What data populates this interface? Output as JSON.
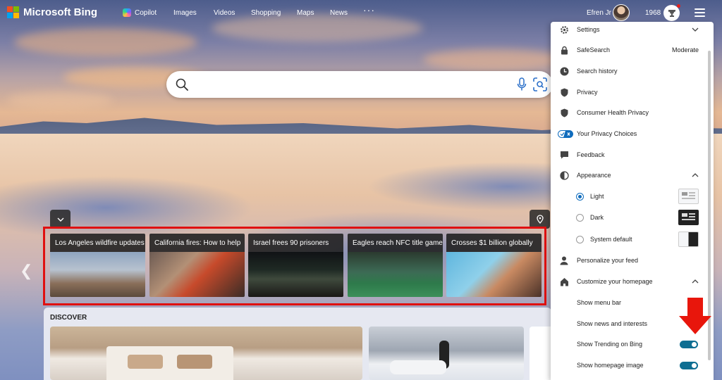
{
  "brand": {
    "name": "Microsoft Bing"
  },
  "nav": {
    "items": [
      "Copilot",
      "Images",
      "Videos",
      "Shopping",
      "Maps",
      "News"
    ],
    "more": "···"
  },
  "user": {
    "name": "Efren Jr",
    "points": "1968"
  },
  "trending": {
    "cards": [
      {
        "title": "Los Angeles wildfire updates"
      },
      {
        "title": "California fires: How to help"
      },
      {
        "title": "Israel frees 90 prisoners"
      },
      {
        "title": "Eagles reach NFC title game"
      },
      {
        "title": "Crosses $1 billion globally"
      }
    ]
  },
  "discover": {
    "title": "DISCOVER"
  },
  "settings": {
    "items": {
      "settings": "Settings",
      "safesearch": "SafeSearch",
      "safesearch_value": "Moderate",
      "search_history": "Search history",
      "privacy": "Privacy",
      "consumer_health": "Consumer Health Privacy",
      "privacy_choices": "Your Privacy Choices",
      "feedback": "Feedback",
      "appearance": "Appearance",
      "light": "Light",
      "dark": "Dark",
      "system_default": "System default",
      "personalize_feed": "Personalize your feed",
      "customize_homepage": "Customize your homepage",
      "show_menu_bar": "Show menu bar",
      "show_news": "Show news and interests",
      "show_trending": "Show Trending on Bing",
      "show_homepage_image": "Show homepage image"
    },
    "appearance_selected": "Light",
    "toggles": {
      "show_trending": true,
      "show_homepage_image": true
    }
  },
  "colors": {
    "accent": "#0f6cbd",
    "toggle_on": "#0e6e92",
    "highlight": "#e01010"
  }
}
